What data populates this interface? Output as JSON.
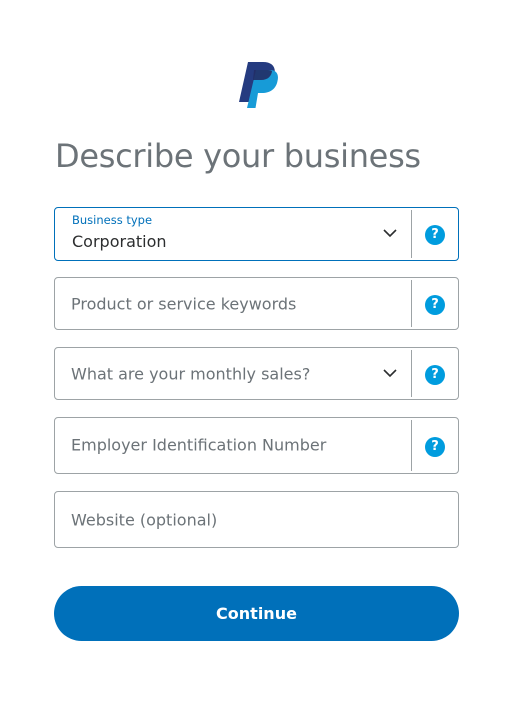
{
  "brand": {
    "logo_icon": "paypal-logo-icon"
  },
  "header": {
    "title": "Describe your business"
  },
  "form": {
    "business_type": {
      "label": "Business type",
      "value": "Corporation",
      "help": "?"
    },
    "keywords": {
      "placeholder": "Product or service keywords",
      "help": "?"
    },
    "monthly_sales": {
      "placeholder": "What are your monthly sales?",
      "help": "?"
    },
    "ein": {
      "placeholder": "Employer Identification Number",
      "help": "?"
    },
    "website": {
      "placeholder": "Website (optional)"
    }
  },
  "actions": {
    "continue_label": "Continue"
  },
  "colors": {
    "primary": "#0070ba",
    "help_icon": "#009cde",
    "border": "#9da3a6",
    "title_text": "#6c7378"
  }
}
